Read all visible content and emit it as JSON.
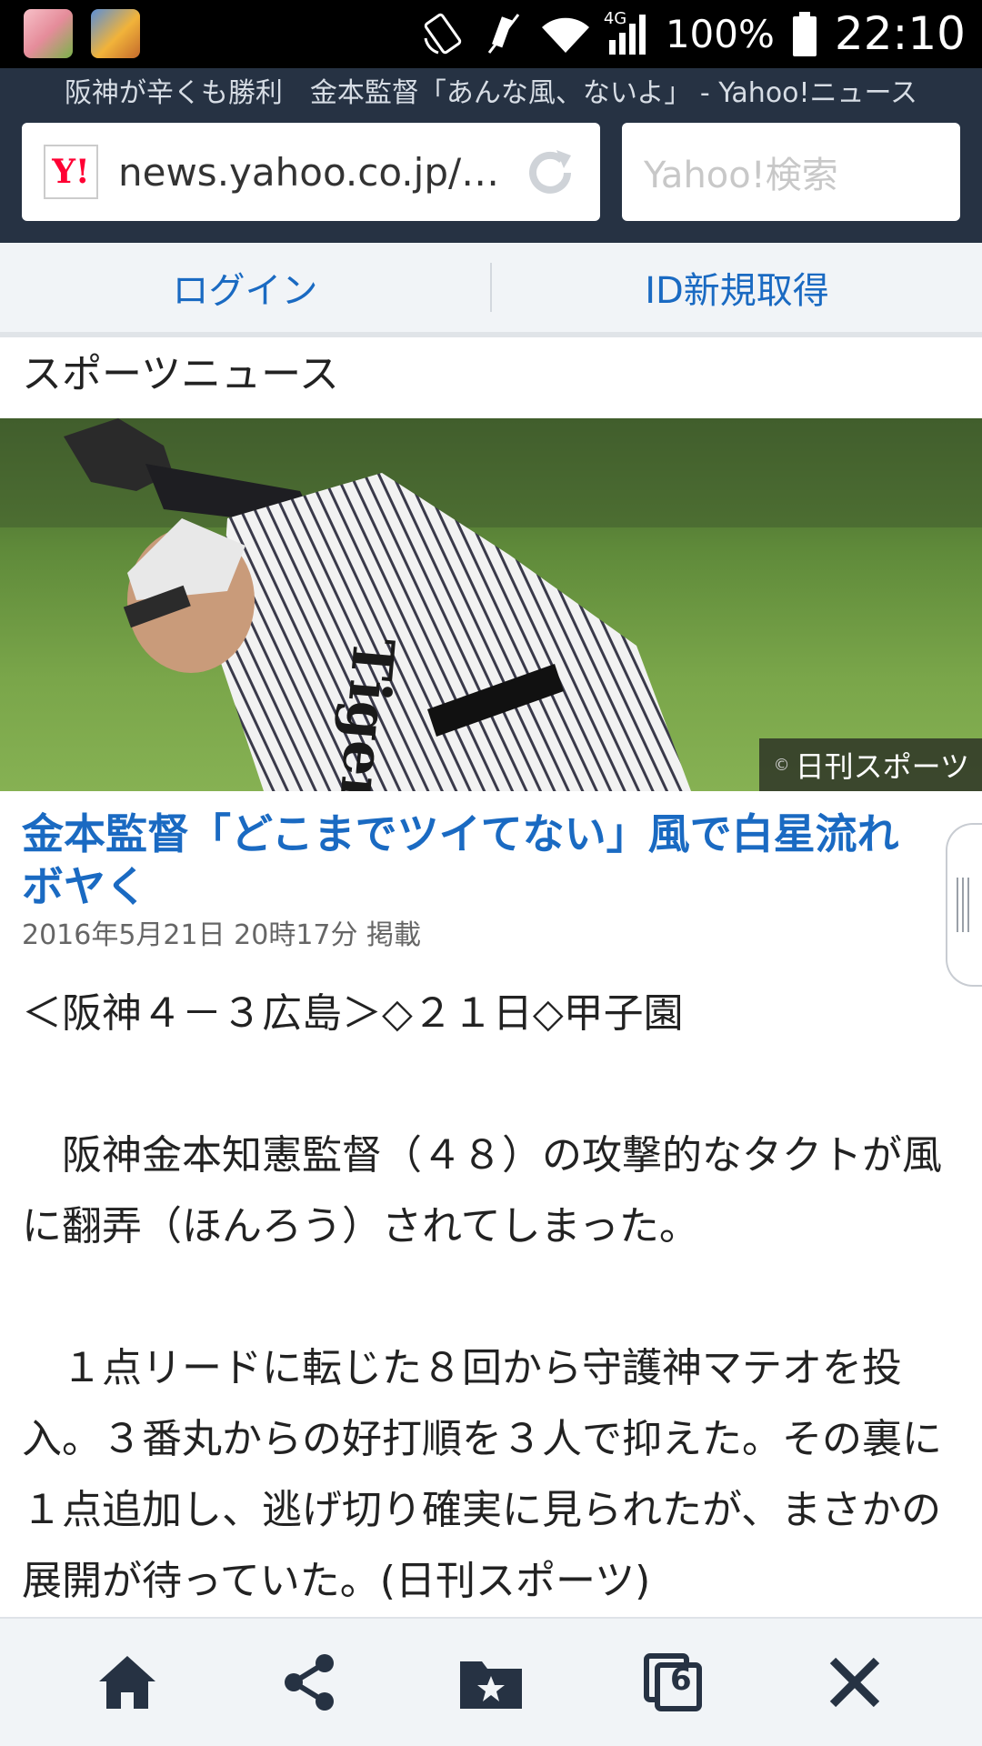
{
  "status_bar": {
    "network_label": "4G",
    "battery": "100%",
    "time": "22:10",
    "icons": [
      "line-app-icon",
      "game-app-icon",
      "rotate-icon",
      "mute-icon",
      "wifi-icon",
      "signal-icon",
      "battery-icon"
    ]
  },
  "browser": {
    "page_title": "阪神が辛くも勝利　金本監督「あんな風、ないよ」 - Yahoo!ニュース",
    "logo_text": "Y!",
    "url": "news.yahoo.co.jp/…",
    "search_placeholder": "Yahoo!検索"
  },
  "account": {
    "login": "ログイン",
    "signup": "ID新規取得"
  },
  "section_title": "スポーツニュース",
  "photo": {
    "jersey_text": "Tigers",
    "credit_mark": "©",
    "credit": "日刊スポーツ"
  },
  "article": {
    "headline": "金本監督「どこまでツイてない」風で白星流れボヤく",
    "date": "2016年5月21日 20時17分 掲載",
    "paragraphs": [
      "＜阪神４－３広島＞◇２１日◇甲子園",
      "　阪神金本知憲監督（４８）の攻撃的なタクトが風に翻弄（ほんろう）されてしまった。",
      "　１点リードに転じた８回から守護神マテオを投入。３番丸からの好打順を３人で抑えた。その裏に１点追加し、逃げ切り確実に見られたが、まさかの展開が待っていた。(日刊スポーツ)"
    ]
  },
  "toolbar": {
    "tab_count": "6",
    "buttons": [
      "home-icon",
      "share-icon",
      "bookmark-icon",
      "tabs-icon",
      "close-icon"
    ]
  }
}
